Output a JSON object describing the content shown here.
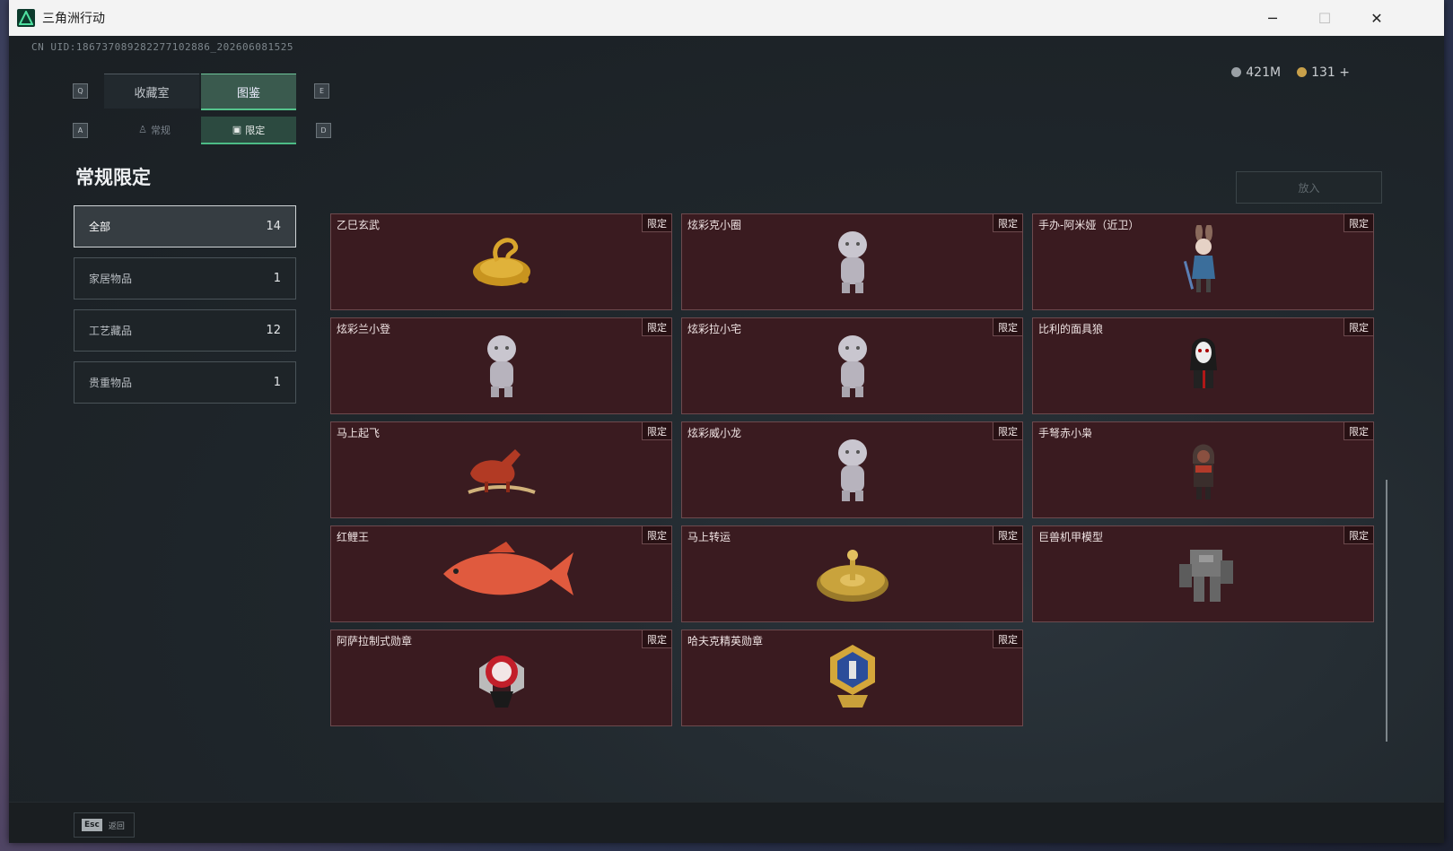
{
  "window": {
    "title": "三角洲行动"
  },
  "uid": "CN UID:1867370892822771028​86_202606081525",
  "currency": {
    "money": "421M",
    "coins": "131",
    "add": "+"
  },
  "keys": {
    "q": "Q",
    "e": "E",
    "a": "A",
    "d": "D",
    "esc": "Esc"
  },
  "tabs": {
    "main": [
      "收藏室",
      "图鉴"
    ],
    "sub": [
      "常规",
      "限定"
    ]
  },
  "heading": "常规限定",
  "categories": [
    {
      "label": "全部",
      "count": "14"
    },
    {
      "label": "家居物品",
      "count": "1"
    },
    {
      "label": "工艺藏品",
      "count": "12"
    },
    {
      "label": "贵重物品",
      "count": "1"
    }
  ],
  "put_button": "放入",
  "tag_label": "限定",
  "items": [
    {
      "name": "乙巳玄武",
      "icon": "golden-snake-turtle-icon"
    },
    {
      "name": "炫彩克小圈",
      "icon": "figurine-icon"
    },
    {
      "name": "手办-阿米娅（近卫）",
      "icon": "rabbit-girl-figure-icon"
    },
    {
      "name": "炫彩兰小登",
      "icon": "figurine-icon"
    },
    {
      "name": "炫彩拉小宅",
      "icon": "figurine-icon"
    },
    {
      "name": "比利的面具狼",
      "icon": "masked-puppet-icon"
    },
    {
      "name": "马上起飞",
      "icon": "red-horse-icon"
    },
    {
      "name": "炫彩威小龙",
      "icon": "figurine-icon"
    },
    {
      "name": "手弩赤小枭",
      "icon": "hooded-figure-icon"
    },
    {
      "name": "红鲤王",
      "icon": "red-carp-icon"
    },
    {
      "name": "马上转运",
      "icon": "golden-wheel-icon"
    },
    {
      "name": "巨兽机甲模型",
      "icon": "mech-model-icon"
    },
    {
      "name": "阿萨拉制式勋章",
      "icon": "medal-icon"
    },
    {
      "name": "哈夫克精英勋章",
      "icon": "elite-medal-icon"
    }
  ],
  "footer": {
    "back": "返回"
  },
  "colors": {
    "accent": "#55c48c",
    "card_bg": "#3a1b20",
    "card_border": "#6d4a4e"
  }
}
